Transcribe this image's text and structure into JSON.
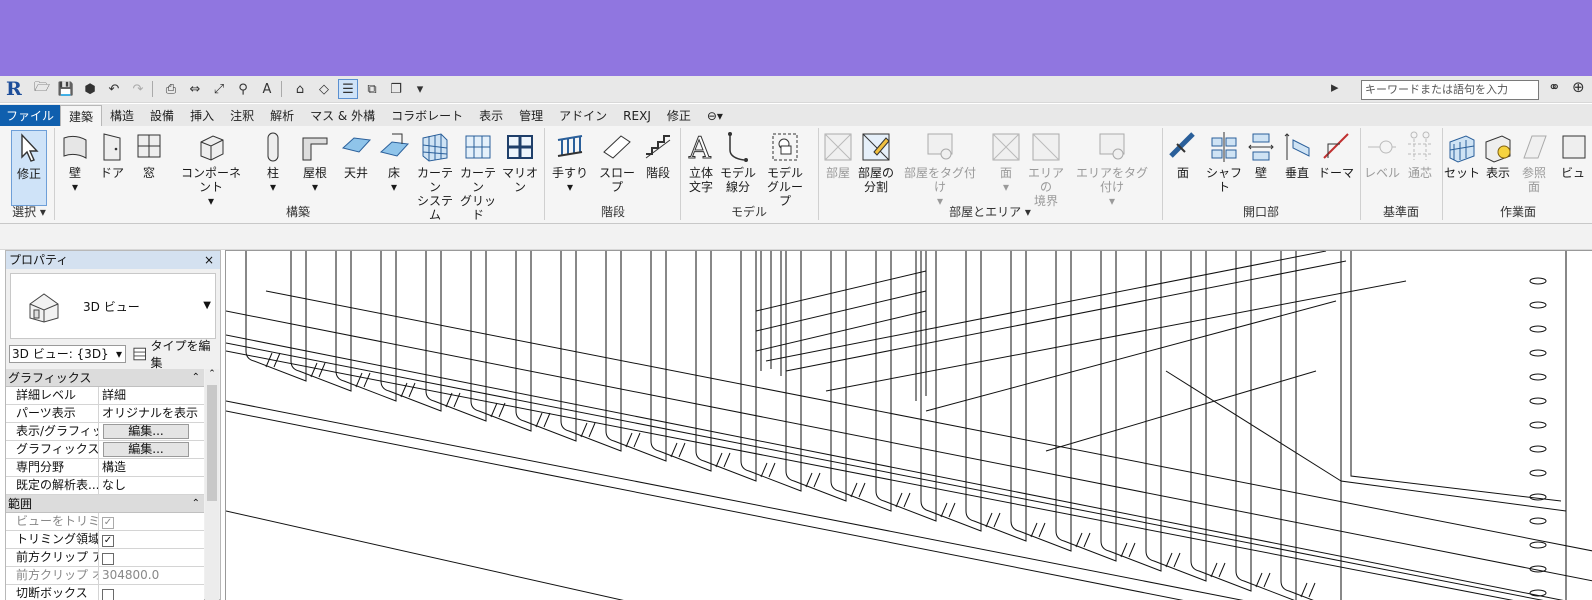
{
  "app": {
    "logo": "R",
    "search_placeholder": "キーワードまたは語句を入力"
  },
  "tabs": [
    "ファイル",
    "建築",
    "構造",
    "設備",
    "挿入",
    "注釈",
    "解析",
    "マス & 外構",
    "コラボレート",
    "表示",
    "管理",
    "アドイン",
    "REXJ",
    "修正"
  ],
  "ribbon": {
    "select": {
      "label": "修正",
      "panel": "選択 ▾"
    },
    "build": {
      "panel": "構築",
      "buttons": [
        {
          "l1": "壁",
          "l2": "▾"
        },
        {
          "l1": "ドア",
          "l2": ""
        },
        {
          "l1": "窓",
          "l2": ""
        },
        {
          "l1": "コンポーネント",
          "l2": "▾"
        },
        {
          "l1": "柱",
          "l2": "▾"
        },
        {
          "l1": "屋根",
          "l2": "▾"
        },
        {
          "l1": "天井",
          "l2": ""
        },
        {
          "l1": "床",
          "l2": "▾"
        },
        {
          "l1": "カーテン",
          "l2": "システム"
        },
        {
          "l1": "カーテン",
          "l2": "グリッド"
        },
        {
          "l1": "マリオン",
          "l2": ""
        }
      ]
    },
    "stairs": {
      "panel": "階段",
      "buttons": [
        {
          "l1": "手すり",
          "l2": "▾"
        },
        {
          "l1": "スロープ",
          "l2": ""
        },
        {
          "l1": "階段",
          "l2": ""
        }
      ]
    },
    "model": {
      "panel": "モデル",
      "buttons": [
        {
          "l1": "立体",
          "l2": "文字"
        },
        {
          "l1": "モデル",
          "l2": "線分"
        },
        {
          "l1": "モデル",
          "l2": "グループ"
        }
      ]
    },
    "room": {
      "panel": "部屋とエリア ▾",
      "buttons": [
        {
          "l1": "部屋",
          "l2": ""
        },
        {
          "l1": "部屋の",
          "l2": "分割"
        },
        {
          "l1": "部屋をタグ付け",
          "l2": "▾"
        },
        {
          "l1": "面",
          "l2": "▾"
        },
        {
          "l1": "エリアの",
          "l2": "境界"
        },
        {
          "l1": "エリアをタグ付け",
          "l2": "▾"
        }
      ]
    },
    "opening": {
      "panel": "開口部",
      "buttons": [
        {
          "l1": "面",
          "l2": ""
        },
        {
          "l1": "シャフト",
          "l2": ""
        },
        {
          "l1": "壁",
          "l2": ""
        },
        {
          "l1": "垂直",
          "l2": ""
        },
        {
          "l1": "ドーマ",
          "l2": ""
        }
      ]
    },
    "datum": {
      "panel": "基準面",
      "buttons": [
        {
          "l1": "レベル",
          "l2": ""
        },
        {
          "l1": "通芯",
          "l2": ""
        }
      ]
    },
    "workplane": {
      "panel": "作業面",
      "buttons": [
        {
          "l1": "セット",
          "l2": ""
        },
        {
          "l1": "表示",
          "l2": ""
        },
        {
          "l1": "参照",
          "l2": "面"
        },
        {
          "l1": "ビュ",
          "l2": ""
        }
      ]
    }
  },
  "properties": {
    "title": "プロパティ",
    "close": "×",
    "type_name": "3D ビュー",
    "view_select": "3D ビュー: {3D}",
    "edit_type": "タイプを編集",
    "sections": [
      {
        "name": "グラフィックス",
        "rows": [
          {
            "k": "詳細レベル",
            "v": "詳細",
            "kind": "text"
          },
          {
            "k": "パーツ表示",
            "v": "オリジナルを表示",
            "kind": "text"
          },
          {
            "k": "表示/グラフィッ...",
            "v": "編集...",
            "kind": "button"
          },
          {
            "k": "グラフィックス表...",
            "v": "編集...",
            "kind": "button"
          },
          {
            "k": "専門分野",
            "v": "構造",
            "kind": "text"
          },
          {
            "k": "既定の解析表...",
            "v": "なし",
            "kind": "text"
          }
        ]
      },
      {
        "name": "範囲",
        "rows": [
          {
            "k": "ビューをトリミング",
            "v": "✓",
            "kind": "checkgrey"
          },
          {
            "k": "トリミング領域...",
            "v": "✓",
            "kind": "check"
          },
          {
            "k": "前方クリップ ア...",
            "v": "",
            "kind": "check"
          },
          {
            "k": "前方クリップ オ...",
            "v": "304800.0",
            "kind": "grey"
          },
          {
            "k": "切断ボックス",
            "v": "",
            "kind": "check"
          }
        ]
      }
    ]
  },
  "colors": {
    "banner": "#9076e0",
    "file_tab": "#0f5fae",
    "panel_header": "#d4e1f0"
  }
}
